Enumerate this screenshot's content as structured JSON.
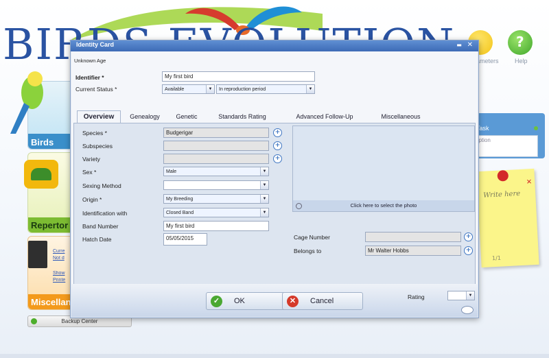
{
  "app": {
    "logo_text": "BIRDS EVOLUTION",
    "toolbar": [
      {
        "label": "ameters",
        "icon": "wrench-icon",
        "color": "#f2c419"
      },
      {
        "label": "Help",
        "icon": "help-icon",
        "color": "#55b93a"
      }
    ],
    "sections": {
      "birds": "Birds",
      "repertory": "Repertor",
      "misc": "Miscellan",
      "misc_links": [
        "Curre",
        "Not d",
        "Show",
        "Printe"
      ]
    },
    "backup_center": "Backup Center",
    "task": {
      "title": "Task",
      "placeholder": "ription"
    },
    "note": {
      "text": "Write here",
      "page": "1/1"
    }
  },
  "dialog": {
    "title": "Identity Card",
    "age": "Unknown Age",
    "identifier": {
      "label": "Identifier *",
      "value": "My first bird"
    },
    "status": {
      "label": "Current Status *",
      "value1": "Available",
      "value2": "In reproduction period"
    },
    "tabs": [
      "Overview",
      "Genealogy",
      "Genetic",
      "Standards Rating",
      "Advanced Follow-Up",
      "Miscellaneous"
    ],
    "fields": {
      "species": {
        "label": "Species *",
        "value": "Budgerigar"
      },
      "subspecies": {
        "label": "Subspecies",
        "value": ""
      },
      "variety": {
        "label": "Variety",
        "value": ""
      },
      "sex": {
        "label": "Sex *",
        "value": "Male"
      },
      "sexing_method": {
        "label": "Sexing Method",
        "value": ""
      },
      "origin": {
        "label": "Origin *",
        "value": "My Breeding"
      },
      "identification": {
        "label": "Identification with",
        "value": "Closed Band"
      },
      "band_number": {
        "label": "Band Number",
        "value": "My first bird"
      },
      "hatch_date": {
        "label": "Hatch Date",
        "value": "05/05/2015"
      },
      "cage_number": {
        "label": "Cage Number",
        "value": ""
      },
      "belongs_to": {
        "label": "Belongs to",
        "value": "Mr Walter Hobbs"
      }
    },
    "photo_caption": "Click here to select the photo",
    "buttons": {
      "ok": "OK",
      "cancel": "Cancel"
    },
    "rating": {
      "label": "Rating",
      "value": ""
    },
    "colors": {
      "title_bar": "#4a7bc4",
      "ok_icon": "#4aa832",
      "cancel_icon": "#d53a2a"
    }
  }
}
